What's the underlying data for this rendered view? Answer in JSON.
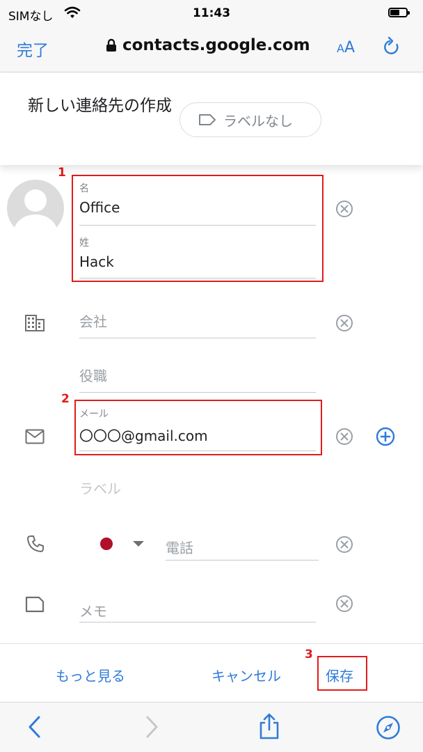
{
  "status_bar": {
    "carrier": "SIMなし",
    "time": "11:43"
  },
  "browser": {
    "done_label": "完了",
    "url": "contacts.google.com",
    "text_size_label_small": "A",
    "text_size_label_large": "A"
  },
  "header": {
    "title": "新しい連絡先の作成",
    "label_chip": "ラベルなし"
  },
  "form": {
    "first_name": {
      "label": "名",
      "value": "Office"
    },
    "last_name": {
      "label": "姓",
      "value": "Hack"
    },
    "company": {
      "placeholder": "会社"
    },
    "job_title": {
      "placeholder": "役職"
    },
    "email": {
      "label": "メール",
      "value": "〇〇〇@gmail.com"
    },
    "email_label": {
      "placeholder": "ラベル"
    },
    "phone": {
      "placeholder": "電話"
    },
    "notes": {
      "placeholder": "メモ"
    }
  },
  "annotations": {
    "step1": "1",
    "step2": "2",
    "step3": "3"
  },
  "actions": {
    "more": "もっと見る",
    "cancel": "キャンセル",
    "save": "保存"
  },
  "icons": {
    "clear": "clear-circle-icon",
    "add": "add-circle-icon",
    "company": "building-icon",
    "email": "mail-icon",
    "phone": "phone-icon",
    "notes": "note-icon"
  },
  "colors": {
    "accent": "#2f7bd9",
    "annotation": "#e21b1b",
    "flag": "#b0102a"
  }
}
